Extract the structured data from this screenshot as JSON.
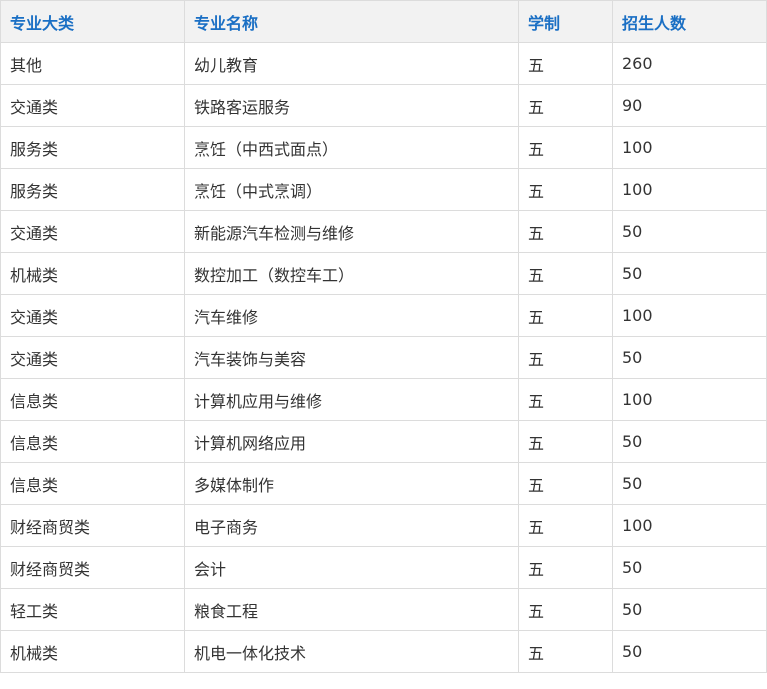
{
  "table": {
    "headers": [
      "专业大类",
      "专业名称",
      "学制",
      "招生人数"
    ],
    "rows": [
      [
        "其他",
        "幼儿教育",
        "五",
        "260"
      ],
      [
        "交通类",
        "铁路客运服务",
        "五",
        "90"
      ],
      [
        "服务类",
        "烹饪（中西式面点）",
        "五",
        "100"
      ],
      [
        "服务类",
        "烹饪（中式烹调）",
        "五",
        "100"
      ],
      [
        "交通类",
        "新能源汽车检测与维修",
        "五",
        "50"
      ],
      [
        "机械类",
        "数控加工（数控车工）",
        "五",
        "50"
      ],
      [
        "交通类",
        "汽车维修",
        "五",
        "100"
      ],
      [
        "交通类",
        "汽车装饰与美容",
        "五",
        "50"
      ],
      [
        "信息类",
        "计算机应用与维修",
        "五",
        "100"
      ],
      [
        "信息类",
        "计算机网络应用",
        "五",
        "50"
      ],
      [
        "信息类",
        "多媒体制作",
        "五",
        "50"
      ],
      [
        "财经商贸类",
        "电子商务",
        "五",
        "100"
      ],
      [
        "财经商贸类",
        "会计",
        "五",
        "50"
      ],
      [
        "轻工类",
        "粮食工程",
        "五",
        "50"
      ],
      [
        "机械类",
        "机电一体化技术",
        "五",
        "50"
      ]
    ]
  },
  "colors": {
    "header_text": "#1a6fc4",
    "header_bg": "#f2f2f2",
    "body_text": "#333333",
    "border": "#dcdcdc"
  }
}
